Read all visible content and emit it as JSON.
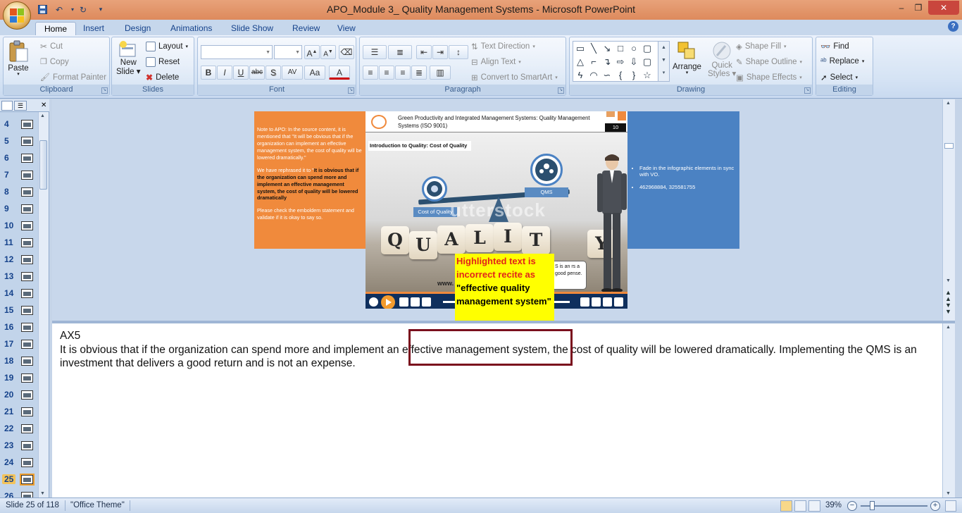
{
  "window": {
    "title": "APO_Module 3_ Quality Management Systems - Microsoft PowerPoint",
    "minimize": "–",
    "restore": "❐",
    "close": "✕"
  },
  "tabs": [
    "Home",
    "Insert",
    "Design",
    "Animations",
    "Slide Show",
    "Review",
    "View"
  ],
  "active_tab": "Home",
  "ribbon": {
    "clipboard": {
      "label": "Clipboard",
      "paste": "Paste",
      "cut": "Cut",
      "copy": "Copy",
      "format_painter": "Format Painter"
    },
    "slides": {
      "label": "Slides",
      "new_slide_1": "New",
      "new_slide_2": "Slide",
      "layout": "Layout",
      "reset": "Reset",
      "delete": "Delete"
    },
    "font": {
      "label": "Font",
      "font_name": "",
      "font_size": "",
      "bold": "B",
      "italic": "I",
      "underline": "U",
      "strike": "abc",
      "shadow": "S",
      "spacing": "AV",
      "case": "Aa",
      "color": "A",
      "grow": "A",
      "shrink": "A"
    },
    "paragraph": {
      "label": "Paragraph",
      "text_direction": "Text Direction",
      "align_text": "Align Text",
      "convert_smartart": "Convert to SmartArt"
    },
    "drawing": {
      "label": "Drawing",
      "arrange": "Arrange",
      "quick_styles_1": "Quick",
      "quick_styles_2": "Styles",
      "shape_fill": "Shape Fill",
      "shape_outline": "Shape Outline",
      "shape_effects": "Shape Effects"
    },
    "editing": {
      "label": "Editing",
      "find": "Find",
      "replace": "Replace",
      "select": "Select"
    }
  },
  "slide_panel": {
    "numbers": [
      "4",
      "5",
      "6",
      "7",
      "8",
      "9",
      "10",
      "11",
      "12",
      "13",
      "14",
      "15",
      "16",
      "17",
      "18",
      "19",
      "20",
      "21",
      "22",
      "23",
      "24",
      "25",
      "26"
    ],
    "selected": "25"
  },
  "slide": {
    "orange_note": {
      "p1": "Note to APO: In the source content, it is mentioned that \"It will be obvious that if the organization can implement an effective management system, the cost of quality will be lowered dramatically.\"",
      "p2_prefix": "We have rephrased it to \"",
      "p2_bold": "It is obvious that if the organization can spend more and implement an effective management system, the cost of quality will be lowered dramatically",
      "p3": "Please check the emboldem statement and validate if it is okay to say so."
    },
    "blue_notes": [
      "Fade in the infographic elements in sync with VO.",
      "462968884, 325581755"
    ],
    "header_title": "Green Productivity and Integrated Management Systems: Quality Management Systems (ISO 9001)",
    "page_number": "10",
    "intro_label": "Introduction to Quality:  Cost of Quality",
    "left_label": "Cost of Quality",
    "right_label": "QMS",
    "cubes": [
      "Q",
      "U",
      "A",
      "L",
      "I",
      "T",
      "Y"
    ],
    "watermark": "utterstock",
    "speech_text": "S is an rs a good pense.",
    "www": "www."
  },
  "callout": {
    "red_text": "Highlighted text is incorrect recite as",
    "quote_open": "\"",
    "black_text": "effective quality management system",
    "quote_close": "\""
  },
  "notes": {
    "line1": "AX5",
    "line2": "It is obvious that if the organization can spend more and implement an effective management system, the cost of quality will be lowered dramatically. Implementing the QMS is an investment that delivers a good return and is not an expense."
  },
  "status": {
    "slide_info": "Slide 25 of 118",
    "theme": "\"Office Theme\"",
    "zoom": "39%"
  },
  "colors": {
    "orange_note": "#f08a3c",
    "blue_note": "#4b82c3",
    "callout_bg": "#ffff00",
    "callout_red": "#e2231a",
    "highlight_border": "#7a0f1d",
    "title_bar": "#dd8a5c"
  }
}
